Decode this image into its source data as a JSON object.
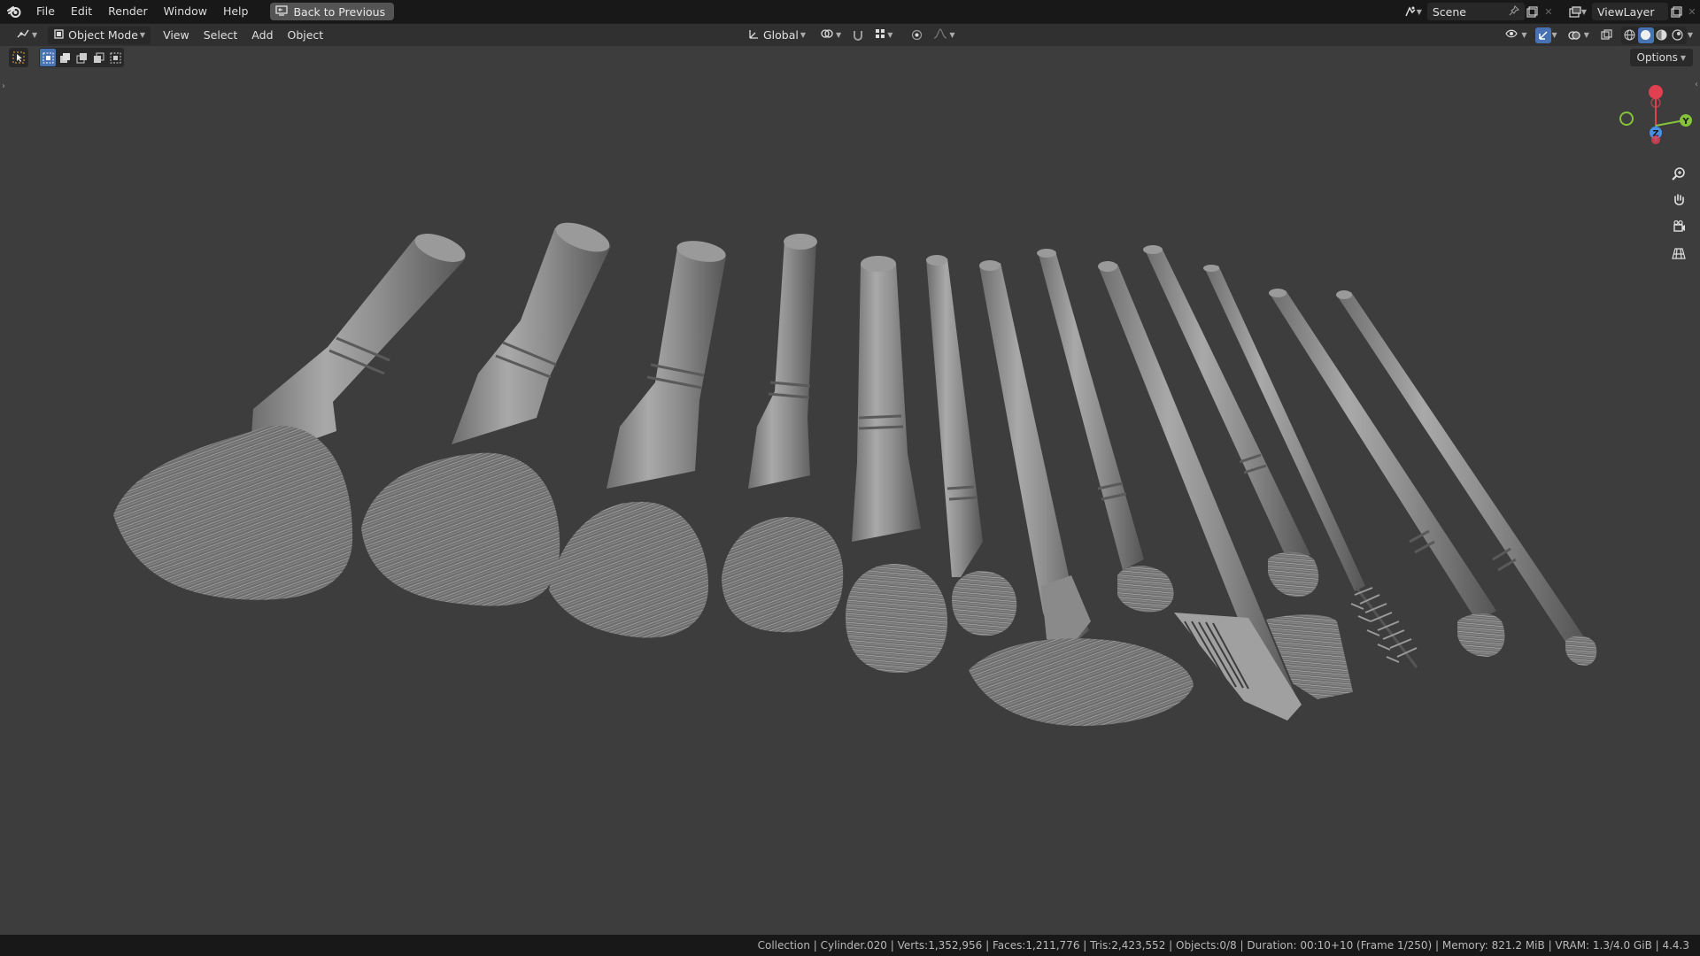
{
  "topbar": {
    "menu": [
      "File",
      "Edit",
      "Render",
      "Window",
      "Help"
    ],
    "back_button": "Back to Previous",
    "scene": "Scene",
    "view_layer": "ViewLayer"
  },
  "viewport_header": {
    "mode": "Object Mode",
    "menu": [
      "View",
      "Select",
      "Add",
      "Object"
    ],
    "orientation": "Global"
  },
  "viewport": {
    "options_label": "Options",
    "gizmo_axes": [
      "X",
      "Y",
      "Z"
    ]
  },
  "status": {
    "text": "Collection | Cylinder.020 | Verts:1,352,956 | Faces:1,211,776 | Tris:2,423,552 | Objects:0/8 | Duration: 00:10+10 (Frame 1/250) | Memory: 821.2 MiB | VRAM: 1.3/4.0 GiB | 4.4.3"
  },
  "colors": {
    "accent": "#4772b3",
    "viewport_bg": "#3d3d3d",
    "x_axis": "#e0404f",
    "y_axis": "#86c23a",
    "z_axis": "#4a8fe6"
  }
}
